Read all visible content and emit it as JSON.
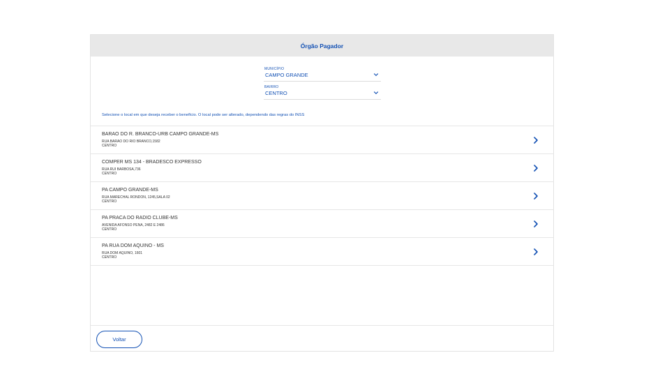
{
  "header": {
    "title": "Órgão Pagador"
  },
  "filters": {
    "municipio": {
      "label": "MUNICÍPIO",
      "value": "CAMPO GRANDE"
    },
    "bairro": {
      "label": "BAIRRO",
      "value": "CENTRO"
    }
  },
  "hint": "Selecione o local em que deseja receber o benefício. O local pode ser alterado, dependendo das regras do INSS",
  "locations": [
    {
      "name": "BARAO DO R. BRANCO-URB CAMPO GRANDE-MS",
      "address": "RUA BARAO DO RIO BRANCO,1582",
      "bairro": "CENTRO"
    },
    {
      "name": "COMPER MS 134 - BRADESCO EXPRESSO",
      "address": "RUA RUI BARBOSA,736",
      "bairro": "CENTRO"
    },
    {
      "name": "PA CAMPO GRANDE-MS",
      "address": "RUA MARECHAL RONDON, 1245,SALA 02",
      "bairro": "CENTRO"
    },
    {
      "name": "PA PRACA DO RADIO CLUBE-MS",
      "address": "AVENIDA AFONSO PENA, 2482 E 2486",
      "bairro": "CENTRO"
    },
    {
      "name": "PA RUA DOM AQUINO - MS",
      "address": "RUA DOM AQUINO, 1601",
      "bairro": "CENTRO"
    }
  ],
  "footer": {
    "back_label": "Voltar"
  },
  "colors": {
    "accent": "#1351b4",
    "header_bg": "#e8e8e8"
  },
  "icons": {
    "dropdown": "chevron-down-icon",
    "row": "chevron-right-icon"
  }
}
